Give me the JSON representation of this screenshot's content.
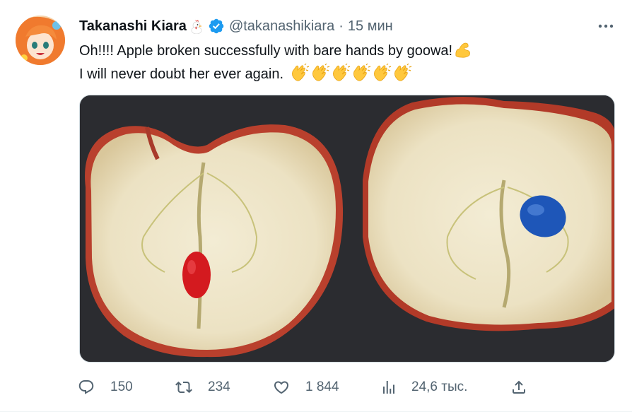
{
  "tweet": {
    "display_name": "Takanashi Kiara",
    "handle": "@takanashikiara",
    "separator": "·",
    "time": "15 мин",
    "text_line1": "Oh!!!! Apple broken successfully with bare hands by goowa!",
    "text_line2": "I will never doubt her ever again.",
    "emoji_flex": "flexed-biceps",
    "emoji_clap_count": 6
  },
  "actions": {
    "reply_count": "150",
    "retweet_count": "234",
    "like_count": "1 844",
    "views_count": "24,6 тыс."
  },
  "colors": {
    "text": "#0f1419",
    "secondary": "#536471",
    "verified": "#1d9bf0"
  },
  "icons": [
    "chicken-icon",
    "verified-badge-icon",
    "more-icon",
    "reply-icon",
    "retweet-icon",
    "like-icon",
    "views-icon",
    "share-icon"
  ]
}
